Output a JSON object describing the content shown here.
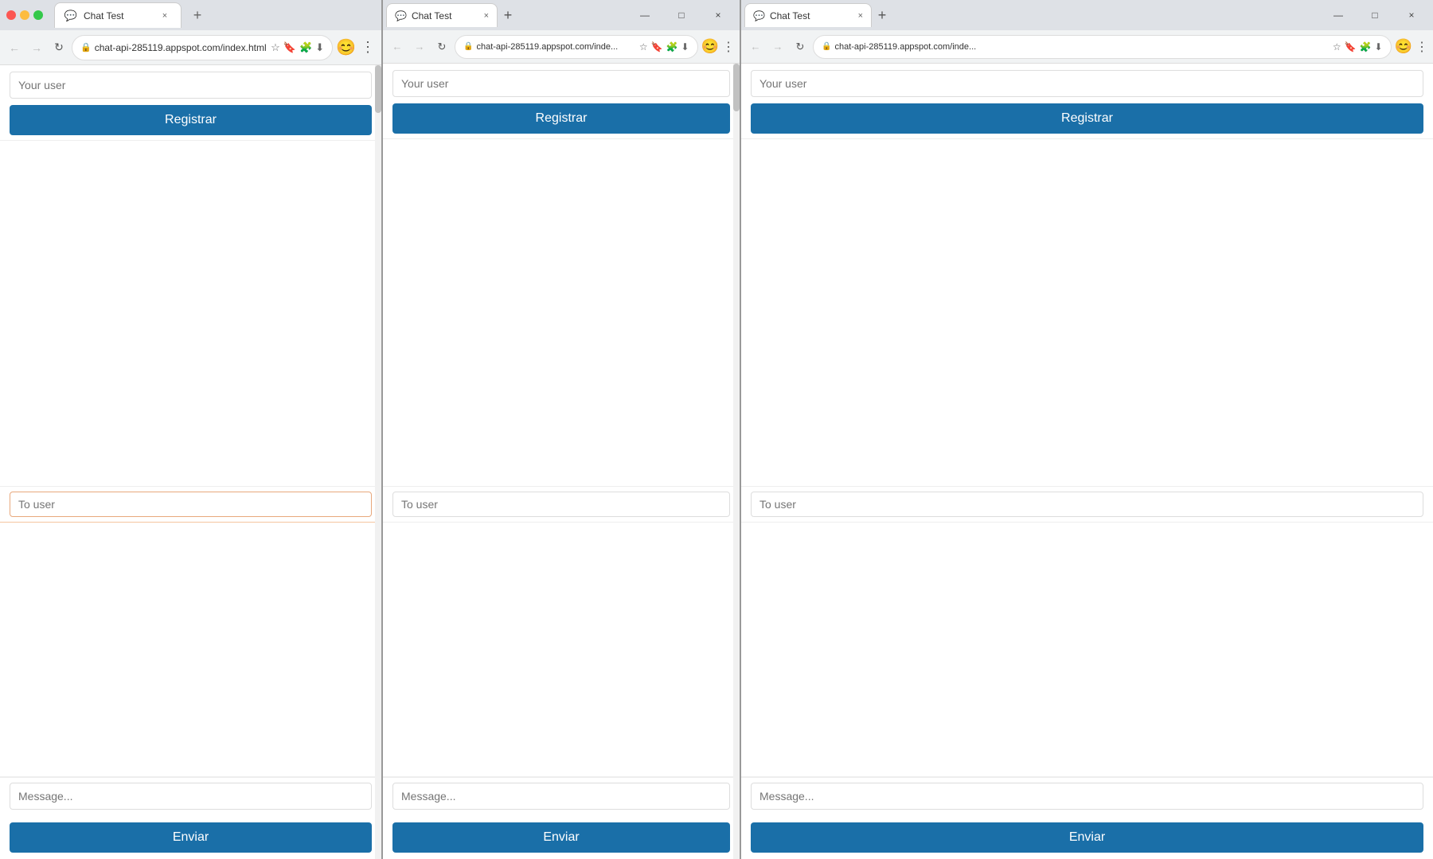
{
  "browsers": [
    {
      "id": "browser-1",
      "type": "chrome-mac",
      "tab": {
        "label": "Chat Test",
        "favicon": "💬",
        "url": "chat-api-285119.appspot.com/index.html"
      },
      "app": {
        "your_user_placeholder": "Your user",
        "registrar_label": "Registrar",
        "to_user_placeholder": "To user",
        "message_placeholder": "Message...",
        "enviar_label": "Enviar"
      }
    },
    {
      "id": "browser-2",
      "type": "chrome-win",
      "tab": {
        "label": "Chat Test",
        "favicon": "💬",
        "url": "chat-api-285119.appspot.com/inde..."
      },
      "app": {
        "your_user_placeholder": "Your user",
        "registrar_label": "Registrar",
        "to_user_placeholder": "To user",
        "message_placeholder": "Message...",
        "enviar_label": "Enviar"
      }
    },
    {
      "id": "browser-3",
      "type": "chrome-win",
      "tab": {
        "label": "Chat Test",
        "favicon": "💬",
        "url": "chat-api-285119.appspot.com/inde..."
      },
      "app": {
        "your_user_placeholder": "Your user",
        "registrar_label": "Registrar",
        "to_user_placeholder": "To user",
        "message_placeholder": "Message...",
        "enviar_label": "Enviar"
      }
    }
  ],
  "icons": {
    "back": "←",
    "forward": "→",
    "reload": "↻",
    "lock": "🔒",
    "star": "☆",
    "bookmark": "🔖",
    "extension": "🧩",
    "profile": "😊",
    "menu": "⋮",
    "close": "×",
    "minimize": "—",
    "maximize": "□",
    "new_tab": "+"
  }
}
